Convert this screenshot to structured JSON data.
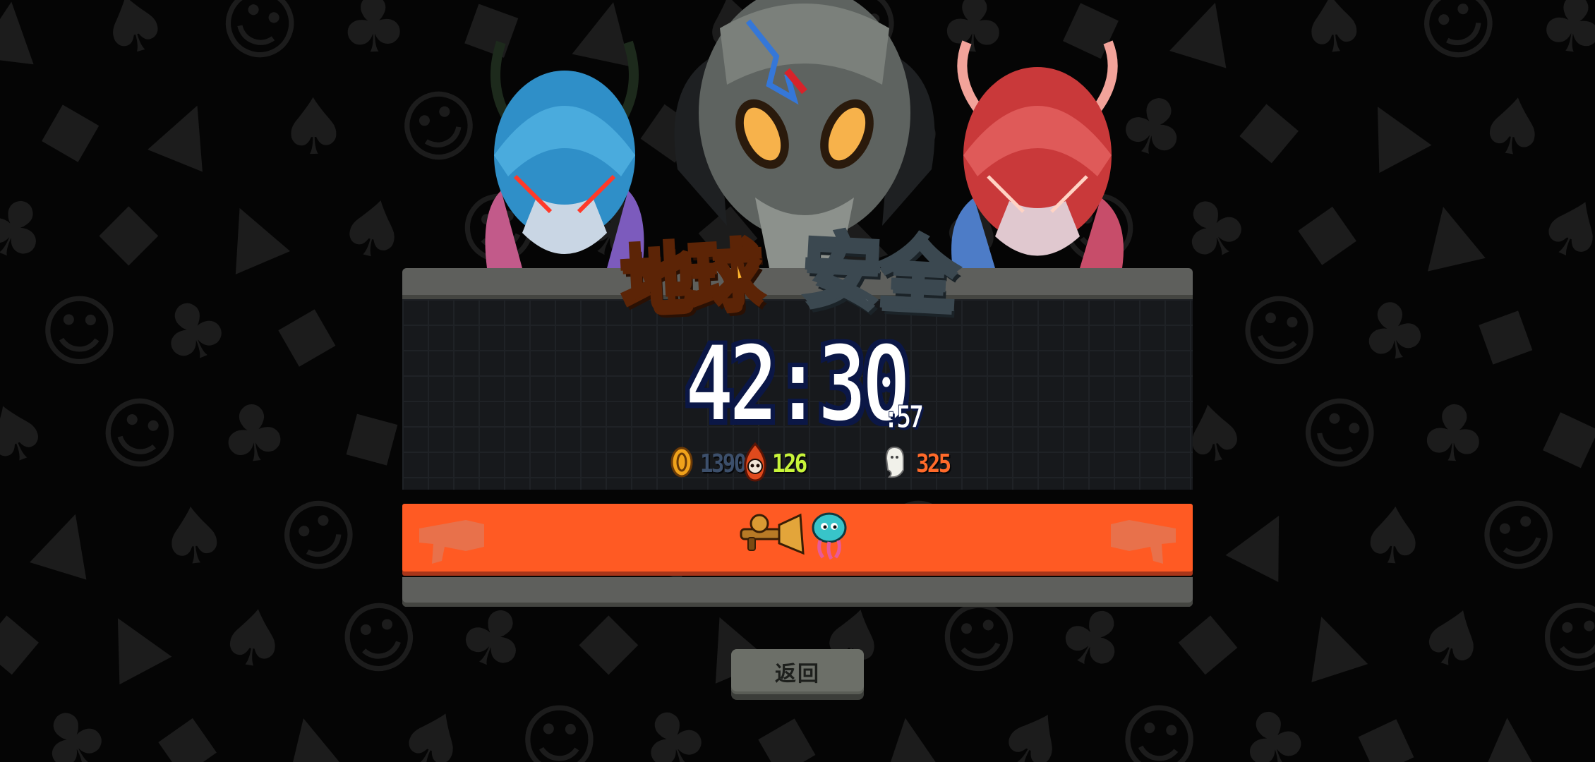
{
  "screen": {
    "title_part1": "地球",
    "title_part2": "安全",
    "timer": "42:30",
    "timer_fraction": ":57"
  },
  "stats": {
    "coins": "1390",
    "kills": "126",
    "souls": "325"
  },
  "icons": {
    "coin": "coin-icon",
    "kills": "skull-flame-icon",
    "souls": "ghost-icon",
    "item1": "trumpet-weapon-icon",
    "item2": "jellyfish-pet-icon"
  },
  "buttons": {
    "back_label": "返回"
  },
  "colors": {
    "accent_orange": "#ff5a23",
    "coin_text": "#3c4f6b",
    "kills_text": "#c8f43a",
    "souls_text": "#ff6a2a",
    "title_earth": "#ffb52e",
    "title_safe": "#e9ecee"
  }
}
